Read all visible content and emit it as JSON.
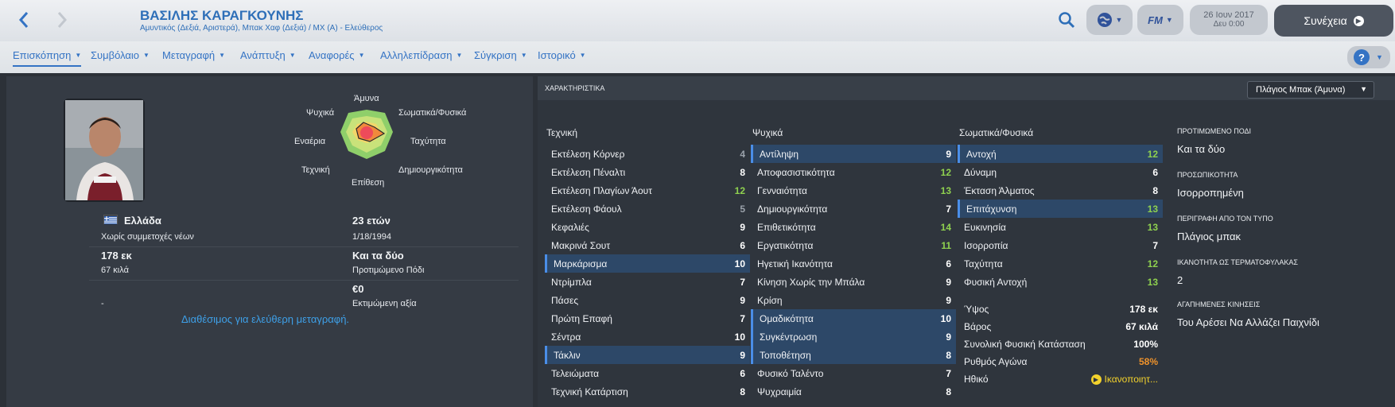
{
  "header": {
    "title": "ΒΑΣΙΛΗΣ ΚΑΡΑΓΚΟΥΝΗΣ",
    "subtitle": "Αμυντικός (Δεξιά, Αριστερά), Μπακ Χαφ (Δεξιά) / ΜΧ (Α) - Ελεύθερος",
    "fm_label": "FM",
    "date": "26 Ιουν 2017",
    "time": "Δευ 0:00",
    "continue_label": "Συνέχεια"
  },
  "tabs": [
    "Επισκόπηση",
    "Συμβόλαιο",
    "Μεταγραφή",
    "Ανάπτυξη",
    "Αναφορές",
    "Αλληλεπίδραση",
    "Σύγκριση",
    "Ιστορικό"
  ],
  "profile": {
    "nation": "Ελλάδα",
    "youth_caps": "Χωρίς συμμετοχές νέων",
    "height": "178 εκ",
    "weight": "67 κιλά",
    "misc": "-",
    "age": "23 ετών",
    "dob": "1/18/1994",
    "foot": "Και τα δύο",
    "foot_label": "Προτιμώμενο Πόδι",
    "value": "€0",
    "value_label": "Εκτιμώμενη αξία",
    "transfer_status": "Διαθέσιμος για ελεύθερη μεταγραφή."
  },
  "radar": {
    "labels": [
      "Άμυνα",
      "Σωματικά/Φυσικά",
      "Ταχύτητα",
      "Δημιουργικότητα",
      "Επίθεση",
      "Τεχνική",
      "Εναέρια",
      "Ψυχικά"
    ],
    "colors": {
      "outer": "#8fcf6a",
      "mid": "#f3d66a",
      "inner": "#f08a3c",
      "core": "#ee4b5a"
    }
  },
  "panel": {
    "title": "ΧΑΡΑΚΤΗΡΙΣΤΙΚΑ",
    "role": "Πλάγιος Μπακ (Άμυνα)"
  },
  "technical": {
    "heading": "Τεχνική",
    "rows": [
      {
        "name": "Εκτέλεση Κόρνερ",
        "value": "4"
      },
      {
        "name": "Εκτέλεση Πέναλτι",
        "value": "8"
      },
      {
        "name": "Εκτέλεση Πλαγίων Άουτ",
        "value": "12"
      },
      {
        "name": "Εκτέλεση Φάουλ",
        "value": "5"
      },
      {
        "name": "Κεφαλιές",
        "value": "9"
      },
      {
        "name": "Μακρινά Σουτ",
        "value": "6"
      },
      {
        "name": "Μαρκάρισμα",
        "value": "10"
      },
      {
        "name": "Ντρίμπλα",
        "value": "7"
      },
      {
        "name": "Πάσες",
        "value": "9"
      },
      {
        "name": "Πρώτη Επαφή",
        "value": "7"
      },
      {
        "name": "Σέντρα",
        "value": "10"
      },
      {
        "name": "Τάκλιν",
        "value": "9"
      },
      {
        "name": "Τελειώματα",
        "value": "6"
      },
      {
        "name": "Τεχνική Κατάρτιση",
        "value": "8"
      }
    ]
  },
  "mental": {
    "heading": "Ψυχικά",
    "rows": [
      {
        "name": "Αντίληψη",
        "value": "9"
      },
      {
        "name": "Αποφασιστικότητα",
        "value": "12"
      },
      {
        "name": "Γενναιότητα",
        "value": "13"
      },
      {
        "name": "Δημιουργικότητα",
        "value": "7"
      },
      {
        "name": "Επιθετικότητα",
        "value": "14"
      },
      {
        "name": "Εργατικότητα",
        "value": "11"
      },
      {
        "name": "Ηγετική Ικανότητα",
        "value": "6"
      },
      {
        "name": "Κίνηση Χωρίς την Μπάλα",
        "value": "9"
      },
      {
        "name": "Κρίση",
        "value": "9"
      },
      {
        "name": "Ομαδικότητα",
        "value": "10"
      },
      {
        "name": "Συγκέντρωση",
        "value": "9"
      },
      {
        "name": "Τοποθέτηση",
        "value": "8"
      },
      {
        "name": "Φυσικό Ταλέντο",
        "value": "7"
      },
      {
        "name": "Ψυχραιμία",
        "value": "8"
      }
    ]
  },
  "physical": {
    "heading": "Σωματικά/Φυσικά",
    "rows": [
      {
        "name": "Αντοχή",
        "value": "12"
      },
      {
        "name": "Δύναμη",
        "value": "6"
      },
      {
        "name": "Έκταση Άλματος",
        "value": "8"
      },
      {
        "name": "Επιτάχυνση",
        "value": "13"
      },
      {
        "name": "Ευκινησία",
        "value": "13"
      },
      {
        "name": "Ισορροπία",
        "value": "7"
      },
      {
        "name": "Ταχύτητα",
        "value": "12"
      },
      {
        "name": "Φυσική Αντοχή",
        "value": "13"
      }
    ],
    "extra": [
      {
        "name": "Ύψος",
        "value": "178 εκ"
      },
      {
        "name": "Βάρος",
        "value": "67 κιλά"
      },
      {
        "name": "Συνολική Φυσική Κατάσταση",
        "value": "100%"
      },
      {
        "name": "Ρυθμός Αγώνα",
        "value": "58%"
      },
      {
        "name": "Ηθικό",
        "value": "Ικανοποιητ..."
      }
    ]
  },
  "info": [
    {
      "label": "ΠΡΟΤΙΜΩΜΕΝΟ ΠΟΔΙ",
      "value": "Και τα δύο"
    },
    {
      "label": "ΠΡΟΣΩΠΙΚΟΤΗΤΑ",
      "value": "Ισορροπημένη"
    },
    {
      "label": "ΠΕΡΙΓΡΑΦΗ ΑΠΟ ΤΟΝ ΤΥΠΟ",
      "value": "Πλάγιος μπακ"
    },
    {
      "label": "ΙΚΑΝΟΤΗΤΑ ΩΣ ΤΕΡΜΑΤΟΦΥΛΑΚΑΣ",
      "value": "2"
    },
    {
      "label": "ΑΓΑΠΗΜΕΝΕΣ ΚΙΝΗΣΕΙΣ",
      "value": "Του Αρέσει Να Αλλάζει Παιχνίδι"
    }
  ]
}
